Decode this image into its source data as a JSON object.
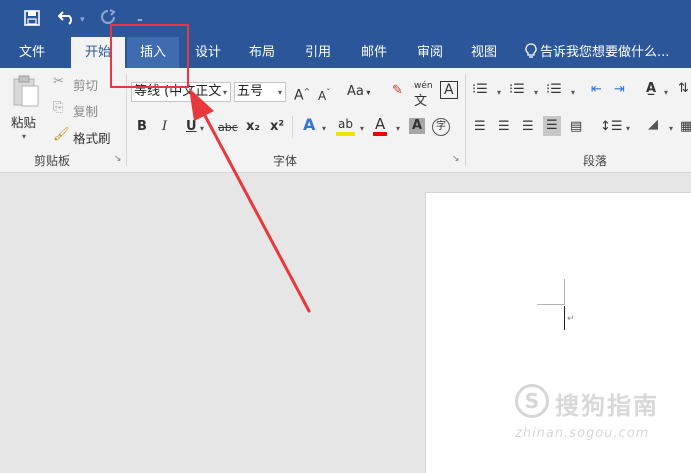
{
  "quick_access": {
    "save_icon": "save-icon",
    "undo_icon": "undo-icon",
    "redo_icon": "redo-icon",
    "customize_icon": "customize-qat-icon"
  },
  "tabs": [
    {
      "label": "文件"
    },
    {
      "label": "开始"
    },
    {
      "label": "插入"
    },
    {
      "label": "设计"
    },
    {
      "label": "布局"
    },
    {
      "label": "引用"
    },
    {
      "label": "邮件"
    },
    {
      "label": "审阅"
    },
    {
      "label": "视图"
    }
  ],
  "search": {
    "text": "告诉我您想要做什么..."
  },
  "clipboard": {
    "paste": "粘贴",
    "cut": "剪切",
    "copy": "复制",
    "format_painter": "格式刷",
    "group": "剪贴板"
  },
  "font": {
    "name": "等线 (中文正文",
    "size": "五号",
    "group": "字体",
    "aa": "Aa",
    "bold": "B",
    "italic": "I",
    "underline": "U",
    "strike": "abc",
    "sub": "x₂",
    "sup": "x²",
    "phonetic": "wén",
    "phonetic_char": "文",
    "border_char": "A",
    "enclose_char": "字"
  },
  "paragraph": {
    "group": "段落"
  },
  "watermark": {
    "brand": "搜狗指南",
    "url": "zhinan.sogou.com",
    "logo": "S"
  },
  "colors": {
    "titlebar": "#2b579a",
    "highlight": "#e8383d",
    "ribbon": "#f3f3f3"
  }
}
